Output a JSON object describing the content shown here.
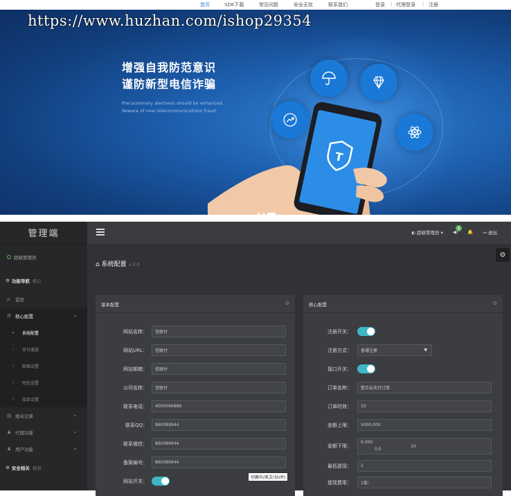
{
  "nav": {
    "items": [
      "首页",
      "SDK下载",
      "常见问题",
      "安全无忧",
      "联系我们"
    ],
    "account": [
      "登录",
      "代理登录",
      "注册"
    ]
  },
  "watermark": "https://www.huzhan.com/ishop29354",
  "hero": {
    "headline_1": "增强自我防范意识",
    "headline_2": "谨防新型电信诈骗",
    "sub_1": "Precautionary alertness should be enhanced.",
    "sub_2": "Beware of new telecommunications fraud."
  },
  "admin": {
    "brand": "管理端",
    "user": "超级管理员",
    "header": {
      "role": "超级管理员",
      "notify_count": "1",
      "logout": "退出"
    },
    "sidebar": {
      "section_1": "功能导航",
      "section_1_tag": "核心",
      "items": [
        {
          "label": "首页"
        },
        {
          "label": "核心配置"
        },
        {
          "label": "系统配置"
        },
        {
          "label": "支付通道"
        },
        {
          "label": "邮箱设置"
        },
        {
          "label": "短信设置"
        },
        {
          "label": "接单设置"
        },
        {
          "label": "相关记录"
        },
        {
          "label": "代理功能"
        },
        {
          "label": "用户功能"
        }
      ],
      "section_2": "安全相关",
      "section_2_tag": "核验"
    },
    "page_title": "系统配置",
    "page_version": "v 2.0",
    "basic": {
      "title": "基本配置",
      "fields": [
        {
          "label": "网站名称：",
          "value": "信联付"
        },
        {
          "label": "网站URL：",
          "value": "信联付"
        },
        {
          "label": "网站邮箱：",
          "value": "信联付"
        },
        {
          "label": "公司名称：",
          "value": "信联付"
        },
        {
          "label": "联系电话：",
          "value": "4000066886"
        },
        {
          "label": "联系QQ：",
          "value": "860089944"
        },
        {
          "label": "联系微信：",
          "value": "860089944"
        },
        {
          "label": "备案编号：",
          "value": "860089944"
        }
      ],
      "toggle_label": "网站开关："
    },
    "core": {
      "title": "核心配置",
      "register_switch": "注册开关：",
      "register_mode_label": "注册方式：",
      "register_mode_value": "普通注册",
      "api_switch": "接口开关：",
      "order_name_label": "订单名称：",
      "order_name_value": "整合云支付订单",
      "order_timeout_label": "订单时效：",
      "order_timeout_value": "10",
      "amount_max_label": "金额上限：",
      "amount_max_value": "5000.000",
      "amount_min_label": "金额下限：",
      "amount_min_value": "0.000",
      "amount_min_extra_1": "0.0",
      "amount_min_extra_2": "10",
      "min_withdraw_label": "最低提现：",
      "min_withdraw_value": "1",
      "withdraw_fee_label": "提现费率：",
      "withdraw_fee_value": "1现："
    },
    "tooltip": "切换中/英文(Shift)"
  }
}
